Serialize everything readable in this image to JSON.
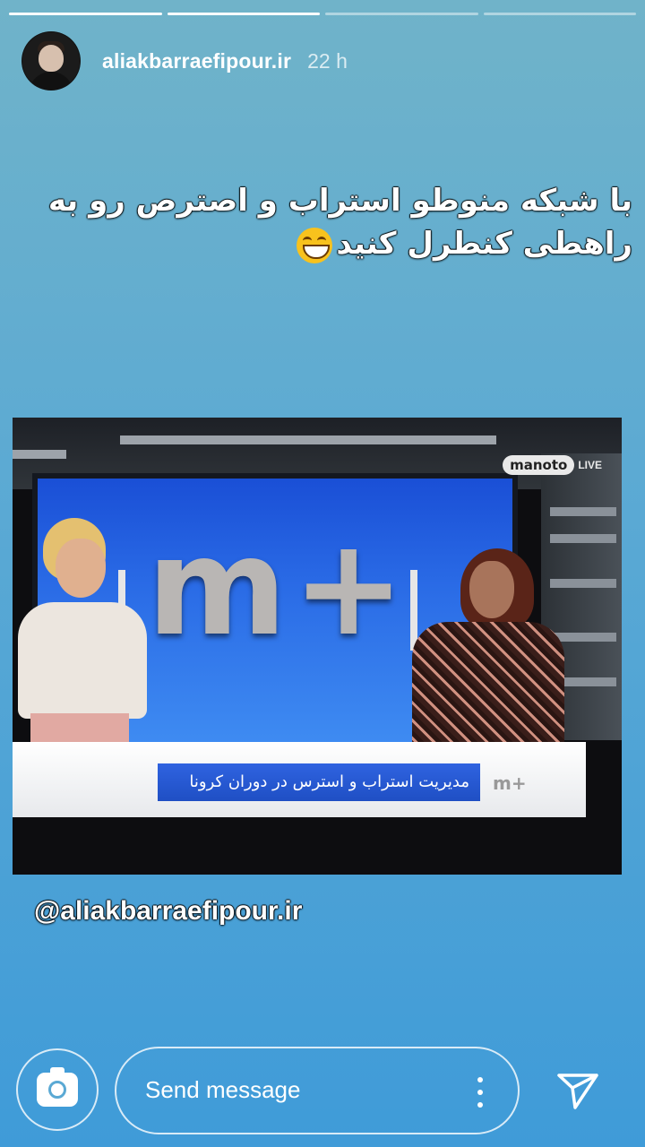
{
  "story": {
    "segments": [
      {
        "state": "viewed"
      },
      {
        "state": "viewed"
      },
      {
        "state": "pending"
      },
      {
        "state": "pending"
      }
    ],
    "username": "aliakbarraefipour.ir",
    "time": "22 h",
    "caption_line1": "با شبکه منوطو استراب و اصترص رو به",
    "caption_line2": "راهطی کنطرل کنید",
    "emoji": "grinning-face-with-smiling-eyes",
    "watermark": "@aliakbarraefipour.ir"
  },
  "tv": {
    "channel_logo": "manoto",
    "live_label": "LIVE",
    "big_logo": "m+",
    "lower_third": "مدیریت استراب و استرس در دوران کرونا",
    "small_logo": "m+"
  },
  "reply_bar": {
    "placeholder": "Send message",
    "camera_icon": "camera-icon",
    "more_icon": "more-vertical-icon",
    "send_icon": "send-icon"
  },
  "colors": {
    "background_top": "#70b3c9",
    "background_bottom": "#3f9bd8",
    "screen_blue": "#2a6be6"
  }
}
